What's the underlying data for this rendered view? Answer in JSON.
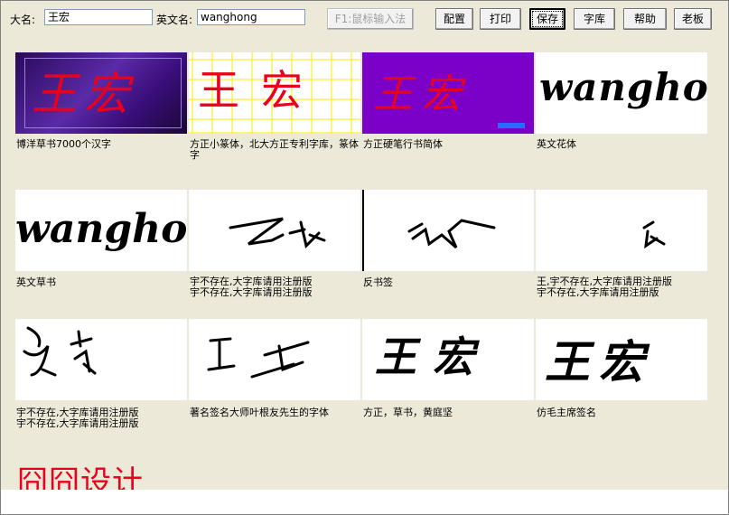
{
  "toolbar": {
    "name_label": "大名:",
    "name_value": "王宏",
    "en_label": "英文名:",
    "en_value": "wanghong",
    "ime_button": "F1:鼠标输入法",
    "buttons": {
      "config": "配置",
      "print": "打印",
      "save": "保存",
      "fontlib": "字库",
      "help": "帮助",
      "boss": "老板"
    }
  },
  "tiles": {
    "t1": {
      "caption": "博洋草书7000个汉字",
      "text": "王宏"
    },
    "t2": {
      "caption": "方正小篆体，北大方正专利字库，篆体字",
      "text": "王宏"
    },
    "t3": {
      "caption": "方正硬笔行书简体",
      "text": "王宏"
    },
    "t4": {
      "caption": "英文花体",
      "text": "wangho"
    },
    "t5": {
      "caption": "英文草书",
      "text": "wanghon"
    },
    "t6": {
      "caption": "宇不存在,大字库请用注册版\n宇不存在,大字库请用注册版"
    },
    "t7": {
      "caption": "反书签"
    },
    "t8": {
      "caption": "王,宇不存在,大字库请用注册版\n宇不存在,大字库请用注册版"
    },
    "t9": {
      "caption": "宇不存在,大字库请用注册版\n宇不存在,大字库请用注册版"
    },
    "t10": {
      "caption": "著名签名大师叶根友先生的字体"
    },
    "t11": {
      "caption": "方正，草书，黄庭坚",
      "text": "王宏"
    },
    "t12": {
      "caption": "仿毛主席签名",
      "text": "王宏"
    }
  },
  "brand": "囧囧设计",
  "colors": {
    "accent_red": "#e8001c",
    "bg": "#ece9d8",
    "purple": "#7b00c8",
    "grid_yellow": "#ffe800"
  }
}
